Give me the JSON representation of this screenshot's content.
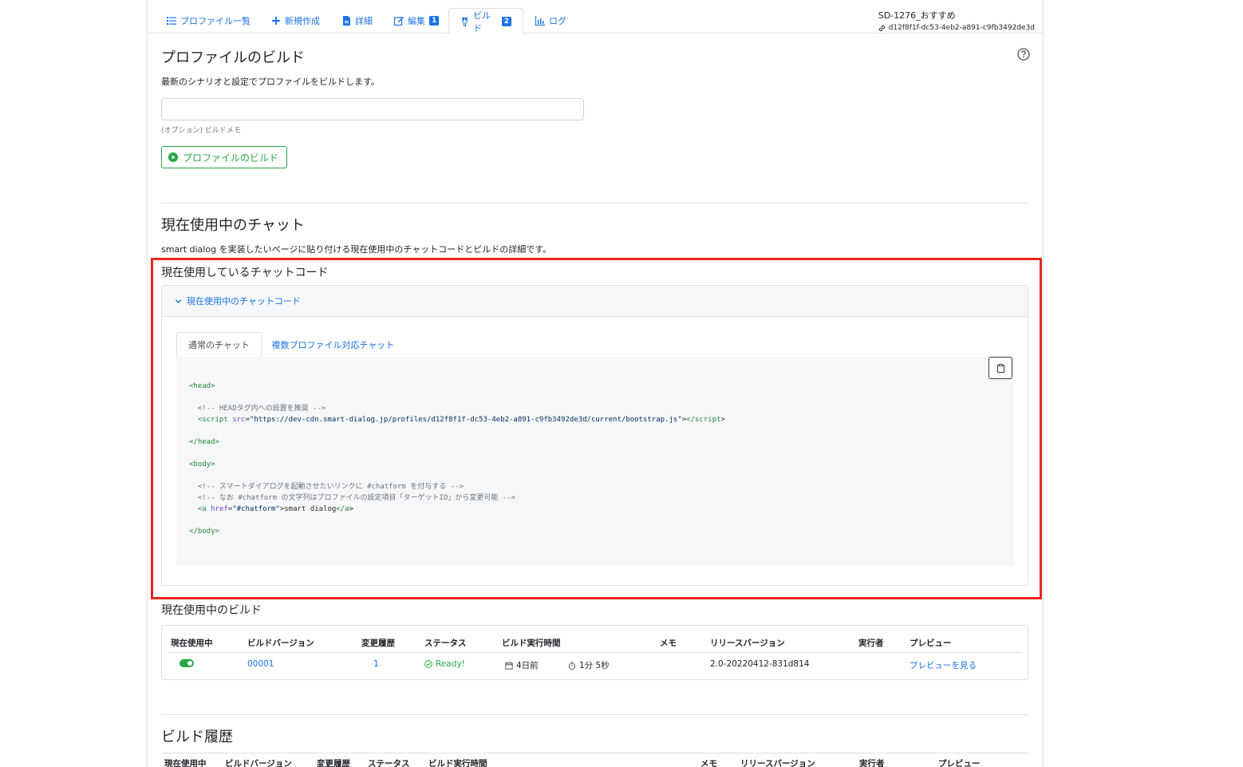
{
  "nav": {
    "tabs": [
      {
        "label": "プロファイル一覧",
        "icon": "list-icon"
      },
      {
        "label": "新規作成",
        "icon": "plus-icon"
      },
      {
        "label": "詳細",
        "icon": "file-icon"
      },
      {
        "label": "編集",
        "icon": "edit-icon",
        "badge": "1"
      },
      {
        "label": "ビルド",
        "icon": "build-icon",
        "badge": "2",
        "active": true
      },
      {
        "label": "ログ",
        "icon": "chart-icon"
      }
    ],
    "profile_name": "SD-1276_おすすめ",
    "profile_uuid": "d12f8f1f-dc53-4eb2-a891-c9fb3492de3d"
  },
  "build_section": {
    "title": "プロファイルのビルド",
    "description": "最新のシナリオと設定でプロファイルをビルドします。",
    "memo_value": "",
    "memo_help": "(オプション) ビルドメモ",
    "build_button": "プロファイルのビルド"
  },
  "chat_section": {
    "title": "現在使用中のチャット",
    "description": "smart dialog を実装したいページに貼り付ける現在使用中のチャットコードとビルドの詳細です。",
    "code_title": "現在使用しているチャットコード",
    "collapse_label": "現在使用中のチャットコード",
    "subtabs": [
      "通常のチャット",
      "複数プロファイル対応チャット"
    ],
    "code": {
      "head_open": "<head>",
      "comment1": "<!-- HEADタグ内への設置を推奨 -->",
      "script_src": "https://dev-cdn.smart-dialog.jp/profiles/d12f8f1f-dc53-4eb2-a891-c9fb3492de3d/current/bootstrap.js",
      "head_close": "</head>",
      "body_open": "<body>",
      "comment2": "<!-- スマートダイアログを起動させたいリンクに #chatform を付与する -->",
      "comment3": "<!-- なお #chatform の文字列はプロファイルの設定項目「ターゲットID」から変更可能 -->",
      "anchor_href": "#chatform",
      "anchor_text": "smart dialog",
      "body_close": "</body>"
    }
  },
  "current_build": {
    "title": "現在使用中のビルド",
    "columns": [
      "現在使用中",
      "ビルドバージョン",
      "変更履歴",
      "ステータス",
      "ビルド実行時間",
      "メモ",
      "リリースバージョン",
      "実行者",
      "プレビュー"
    ],
    "row": {
      "version": "00001",
      "changes": "1",
      "status": "Ready!",
      "built_ago": "4日前",
      "duration": "1分 5秒",
      "memo": "",
      "release": "2.0-20220412-831d814",
      "executor": "",
      "preview": "プレビューを見る"
    }
  },
  "history": {
    "title": "ビルド履歴",
    "columns": [
      "現在使用中",
      "ビルドバージョン",
      "変更履歴",
      "ステータス",
      "ビルド実行時間",
      "メモ",
      "リリースバージョン",
      "実行者",
      "プレビュー"
    ]
  },
  "colors": {
    "accent": "#1a73e8",
    "success": "#28a745",
    "highlight": "#e8261d"
  }
}
